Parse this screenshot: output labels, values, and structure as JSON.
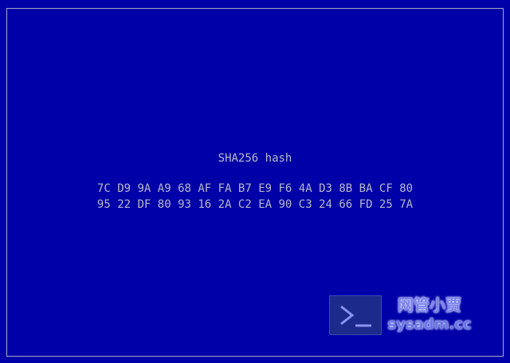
{
  "screen": {
    "title": "SHA256 hash",
    "hash_lines": [
      "7C D9 9A A9 68 AF FA B7 E9 F6 4A D3 8B BA CF 80",
      "95 22 DF 80 93 16 2A C2 EA 90 C3 24 66 FD 25 7A"
    ]
  },
  "watermark": {
    "icon": "terminal-prompt-icon",
    "text_cn": "网管小贾",
    "text_en": "sysadm.cc"
  },
  "colors": {
    "background": "#0000a8",
    "text": "#b8b8c8",
    "border": "#a8a8c0"
  }
}
